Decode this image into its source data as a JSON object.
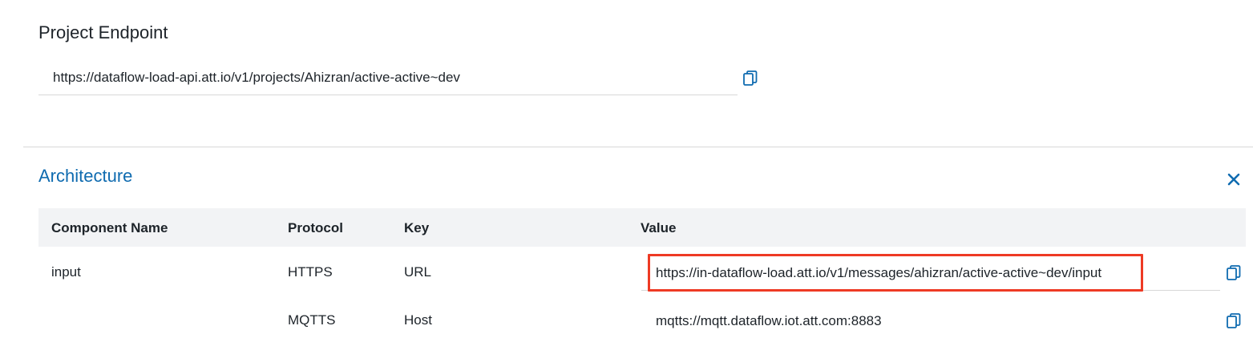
{
  "project_endpoint": {
    "title": "Project Endpoint",
    "url": "https://dataflow-load-api.att.io/v1/projects/Ahizran/active-active~dev"
  },
  "architecture": {
    "title": "Architecture",
    "columns": [
      "Component Name",
      "Protocol",
      "Key",
      "Value"
    ],
    "rows": [
      {
        "component": "input",
        "protocol": "HTTPS",
        "key": "URL",
        "value": "https://in-dataflow-load.att.io/v1/messages/ahizran/active-active~dev/input",
        "highlighted": true
      },
      {
        "component": "",
        "protocol": "MQTTS",
        "key": "Host",
        "value": "mqtts://mqtt.dataflow.iot.att.com:8883",
        "highlighted": false
      }
    ]
  },
  "icons": {
    "copy": "copy-icon",
    "close": "close-icon"
  },
  "colors": {
    "accent": "#0f6bb0",
    "highlight": "#ee3a24",
    "header_bg": "#f2f3f5"
  }
}
